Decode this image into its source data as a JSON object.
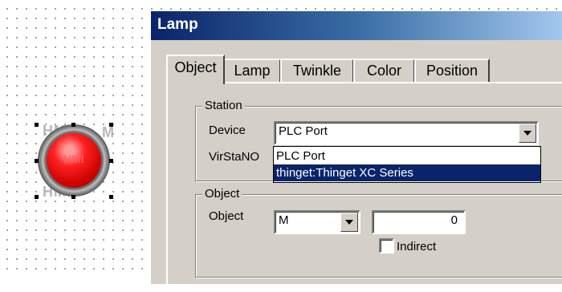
{
  "canvas": {
    "lamp": {
      "ghost_text_top": "HMI",
      "ghost_text_side": "M",
      "lamp_text": "HMI",
      "lamp_color": "#ff2020"
    }
  },
  "dialog": {
    "title": "Lamp",
    "tabs": [
      {
        "label": "Object",
        "active": true
      },
      {
        "label": "Lamp",
        "active": false
      },
      {
        "label": "Twinkle",
        "active": false
      },
      {
        "label": "Color",
        "active": false
      },
      {
        "label": "Position",
        "active": false
      }
    ],
    "station": {
      "group_title": "Station",
      "device_label": "Device",
      "device_value": "PLC Port",
      "virstano_label": "VirStaNO",
      "dropdown_options": [
        "PLC Port",
        "thinget:Thinget XC Series"
      ],
      "dropdown_selected_index": 1
    },
    "object": {
      "group_title": "Object",
      "object_label": "Object",
      "object_type": "M",
      "object_number": "0",
      "indirect_label": "Indirect",
      "indirect_checked": false
    }
  }
}
